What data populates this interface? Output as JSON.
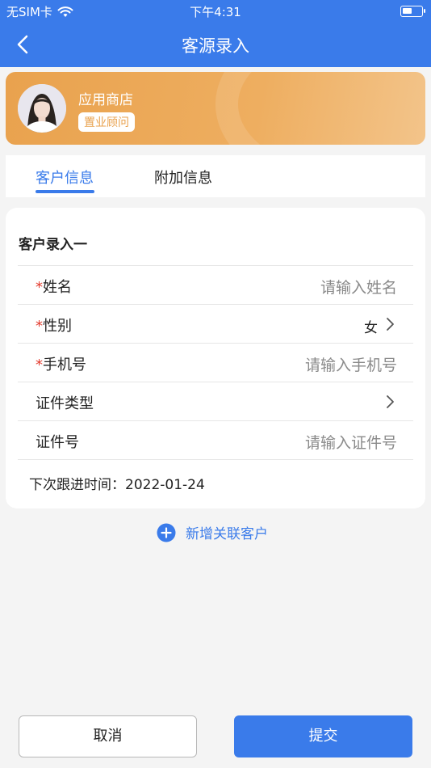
{
  "status_bar": {
    "carrier": "无SIM卡",
    "time": "下午4:31"
  },
  "nav": {
    "title": "客源录入"
  },
  "profile": {
    "name": "应用商店",
    "role": "置业顾问"
  },
  "tabs": [
    {
      "label": "客户信息",
      "active": true
    },
    {
      "label": "附加信息",
      "active": false
    }
  ],
  "form": {
    "section_title": "客户录入一",
    "fields": [
      {
        "required": true,
        "required_mark": "*",
        "label": "姓名",
        "placeholder": "请输入姓名",
        "value": ""
      },
      {
        "required": true,
        "required_mark": "*",
        "label": "性别",
        "value": "女",
        "has_chevron": true
      },
      {
        "required": true,
        "required_mark": "*",
        "label": "手机号",
        "placeholder": "请输入手机号",
        "value": ""
      },
      {
        "required": false,
        "label": "证件类型",
        "value": "",
        "has_chevron": true
      },
      {
        "required": false,
        "label": "证件号",
        "placeholder": "请输入证件号",
        "value": ""
      }
    ],
    "followup_label": "下次跟进时间：",
    "followup_date": "2022-01-24"
  },
  "add_related": {
    "label": "新增关联客户",
    "icon": "plus-circle-icon"
  },
  "buttons": {
    "cancel_label": "取消",
    "submit_label": "提交"
  },
  "colors": {
    "primary": "#3a7bea",
    "accent_orange": "#e9a24e",
    "required": "#e33b2e",
    "background": "#f4f4f4"
  }
}
